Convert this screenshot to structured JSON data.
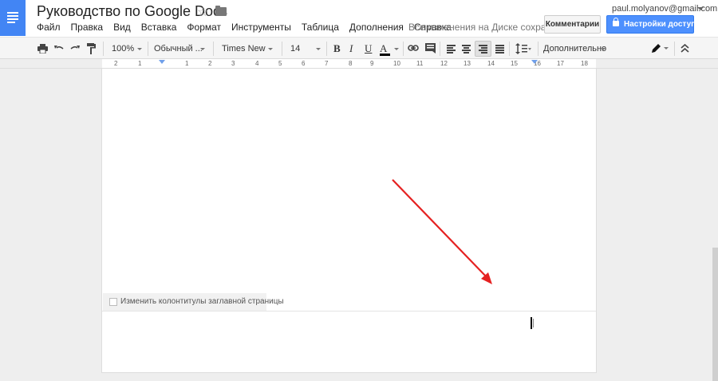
{
  "app": {
    "title": "Руководство по Google Docs",
    "save_status": "Все изменения на Диске сохран..."
  },
  "menu": [
    "Файл",
    "Правка",
    "Вид",
    "Вставка",
    "Формат",
    "Инструменты",
    "Таблица",
    "Дополнения",
    "Справка"
  ],
  "account": {
    "email": "paul.molyanov@gmail.com"
  },
  "buttons": {
    "comments": "Комментарии",
    "share": "Настройки доступа"
  },
  "toolbar": {
    "zoom": "100%",
    "style": "Обычный ...",
    "font": "Times New ...",
    "font_size": "14",
    "bold": "B",
    "italic": "I",
    "underline": "U",
    "text_color": "A",
    "more": "Дополнительно"
  },
  "ruler": {
    "labels": [
      "2",
      "1",
      "1",
      "2",
      "3",
      "4",
      "5",
      "6",
      "7",
      "8",
      "9",
      "10",
      "11",
      "12",
      "13",
      "14",
      "15",
      "16",
      "17",
      "18"
    ]
  },
  "footer": {
    "checkbox_label": "Изменить колонтитулы заглавной страницы"
  },
  "colors": {
    "brand_blue": "#4285f4",
    "share_button": "#4d90fe",
    "annotation_arrow": "#e52121"
  }
}
